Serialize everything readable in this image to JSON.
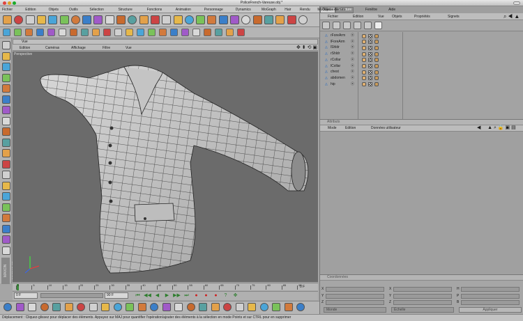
{
  "window": {
    "title": "PoliceFrench-Vareuse.obj *"
  },
  "menubar": [
    "Fichier",
    "Edition",
    "Objets",
    "Outils",
    "Sélection",
    "Structure",
    "Fonctions",
    "Animation",
    "Personnage",
    "Dynamics",
    "MoGraph",
    "Hair",
    "Rendu",
    "Modules externes",
    "Fenêtre",
    "Aide"
  ],
  "viewport": {
    "title": "Vue",
    "menu": [
      "Edition",
      "Caméras",
      "Affichage",
      "Filtre",
      "Vue"
    ],
    "label": "Perspective"
  },
  "objects": {
    "tabs": [
      "Objets",
      "Structure"
    ],
    "menu": [
      "Fichier",
      "Edition",
      "Vue",
      "Objets",
      "Propriétés",
      "Signets"
    ],
    "items": [
      "rForeArm",
      "lForeArm",
      "lShldr",
      "rShldr",
      "rCollar",
      "lCollar",
      "chest",
      "abdomen",
      "hip"
    ]
  },
  "attributes": {
    "title": "Attributs",
    "menu": [
      "Mode",
      "Edition",
      "Données utilisateur"
    ]
  },
  "coordinates": {
    "title": "Coordonnées",
    "labels": [
      "X",
      "Y",
      "Z",
      "X",
      "Y",
      "Z",
      "H",
      "P",
      "B"
    ],
    "mode": "Monde",
    "size": "Échelle",
    "apply": "Appliquer"
  },
  "timeline": {
    "ticks": [
      "0",
      "5",
      "10",
      "15",
      "20",
      "25",
      "30",
      "35",
      "40",
      "45",
      "50",
      "55",
      "60",
      "65",
      "70",
      "75",
      "80",
      "85",
      "90"
    ],
    "end": "0 F",
    "start_field": "0 F",
    "end_field": "90 F"
  },
  "brand": "MAXON CINEMA 4D",
  "status": "Déplacement : Cliquez-glissez pour déplacer des éléments. Appuyez sur MAJ pour quantifier l'opération/ajouter des éléments à la sélection en mode Points et sur CTRL pour en supprimer"
}
